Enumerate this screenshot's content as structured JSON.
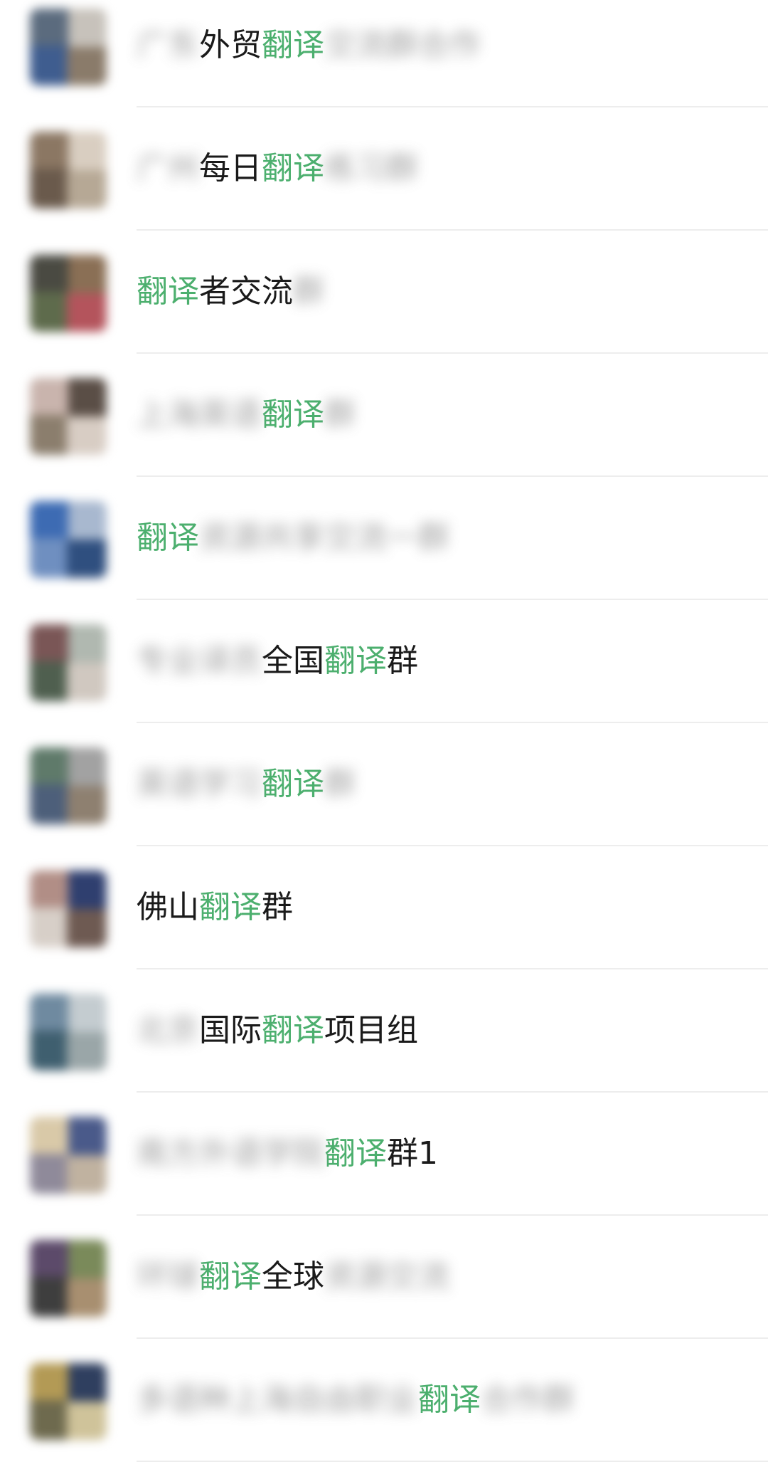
{
  "results": [
    {
      "segments": [
        {
          "t": "广东",
          "k": "blur"
        },
        {
          "t": "外贸",
          "k": "text"
        },
        {
          "t": "翻译",
          "k": "hl"
        },
        {
          "t": "交流群合作",
          "k": "blur"
        }
      ],
      "avatar": [
        "#5b6b7e",
        "#c7c2bb",
        "#3f5d8f",
        "#8a7b6a"
      ]
    },
    {
      "segments": [
        {
          "t": "广州",
          "k": "blur"
        },
        {
          "t": "每日",
          "k": "text"
        },
        {
          "t": "翻译",
          "k": "hl"
        },
        {
          "t": "练习群",
          "k": "blur"
        }
      ],
      "avatar": [
        "#8b7763",
        "#d9cec1",
        "#6a5a4c",
        "#b6a895"
      ]
    },
    {
      "segments": [
        {
          "t": "翻译",
          "k": "hl"
        },
        {
          "t": "者交流",
          "k": "text"
        },
        {
          "t": "群",
          "k": "blur"
        }
      ],
      "avatar": [
        "#4a4a42",
        "#8a6f55",
        "#5e6b4c",
        "#b4545c"
      ]
    },
    {
      "segments": [
        {
          "t": "上海英语",
          "k": "blur"
        },
        {
          "t": "翻译",
          "k": "hl"
        },
        {
          "t": "群",
          "k": "blur"
        }
      ],
      "avatar": [
        "#c9b4ad",
        "#5a4e46",
        "#8b7e6d",
        "#d8cdc4"
      ]
    },
    {
      "segments": [
        {
          "t": "翻译",
          "k": "hl"
        },
        {
          "t": "资源共享交流一群",
          "k": "blur"
        }
      ],
      "avatar": [
        "#3d6bb3",
        "#a8b8cf",
        "#6f8fc0",
        "#2f4f7f"
      ]
    },
    {
      "segments": [
        {
          "t": "专业译员",
          "k": "blur"
        },
        {
          "t": "全国",
          "k": "text"
        },
        {
          "t": "翻译",
          "k": "hl"
        },
        {
          "t": "群",
          "k": "text"
        }
      ],
      "avatar": [
        "#7a5656",
        "#b0b8b0",
        "#4f5f4f",
        "#d0c8c0"
      ]
    },
    {
      "segments": [
        {
          "t": "英语学习",
          "k": "blur"
        },
        {
          "t": "翻译",
          "k": "hl"
        },
        {
          "t": "群",
          "k": "blur"
        }
      ],
      "avatar": [
        "#5f7a6a",
        "#a2a2a2",
        "#4d5f7a",
        "#8e8070"
      ]
    },
    {
      "segments": [
        {
          "t": "佛山",
          "k": "text"
        },
        {
          "t": "翻译",
          "k": "hl"
        },
        {
          "t": "群",
          "k": "text"
        }
      ],
      "avatar": [
        "#b18e86",
        "#2f3f6f",
        "#d7cfc8",
        "#6e5a52"
      ]
    },
    {
      "segments": [
        {
          "t": "北京",
          "k": "blur"
        },
        {
          "t": "国际",
          "k": "text"
        },
        {
          "t": "翻译",
          "k": "hl"
        },
        {
          "t": "项目组",
          "k": "text"
        }
      ],
      "avatar": [
        "#6f8aa0",
        "#c4ccd0",
        "#3f5f6f",
        "#9aa6a8"
      ]
    },
    {
      "segments": [
        {
          "t": "南方外语学院",
          "k": "blur"
        },
        {
          "t": "翻译",
          "k": "hl"
        },
        {
          "t": "群1",
          "k": "text"
        }
      ],
      "avatar": [
        "#d9c9a8",
        "#4a5a8a",
        "#8f8a9a",
        "#c0b2a0"
      ]
    },
    {
      "segments": [
        {
          "t": "环球",
          "k": "blur"
        },
        {
          "t": "翻译",
          "k": "hl"
        },
        {
          "t": "全球",
          "k": "text"
        },
        {
          "t": "资源交流",
          "k": "blur"
        }
      ],
      "avatar": [
        "#5c4a6a",
        "#7a8a5a",
        "#3e3e3e",
        "#a88f70"
      ]
    },
    {
      "segments": [
        {
          "t": "多语种上海自由职业",
          "k": "blur"
        },
        {
          "t": "翻译",
          "k": "hl"
        },
        {
          "t": "合作群",
          "k": "blur"
        }
      ],
      "avatar": [
        "#b39a55",
        "#2f3f5f",
        "#6e6a4e",
        "#cfc39a"
      ]
    }
  ]
}
